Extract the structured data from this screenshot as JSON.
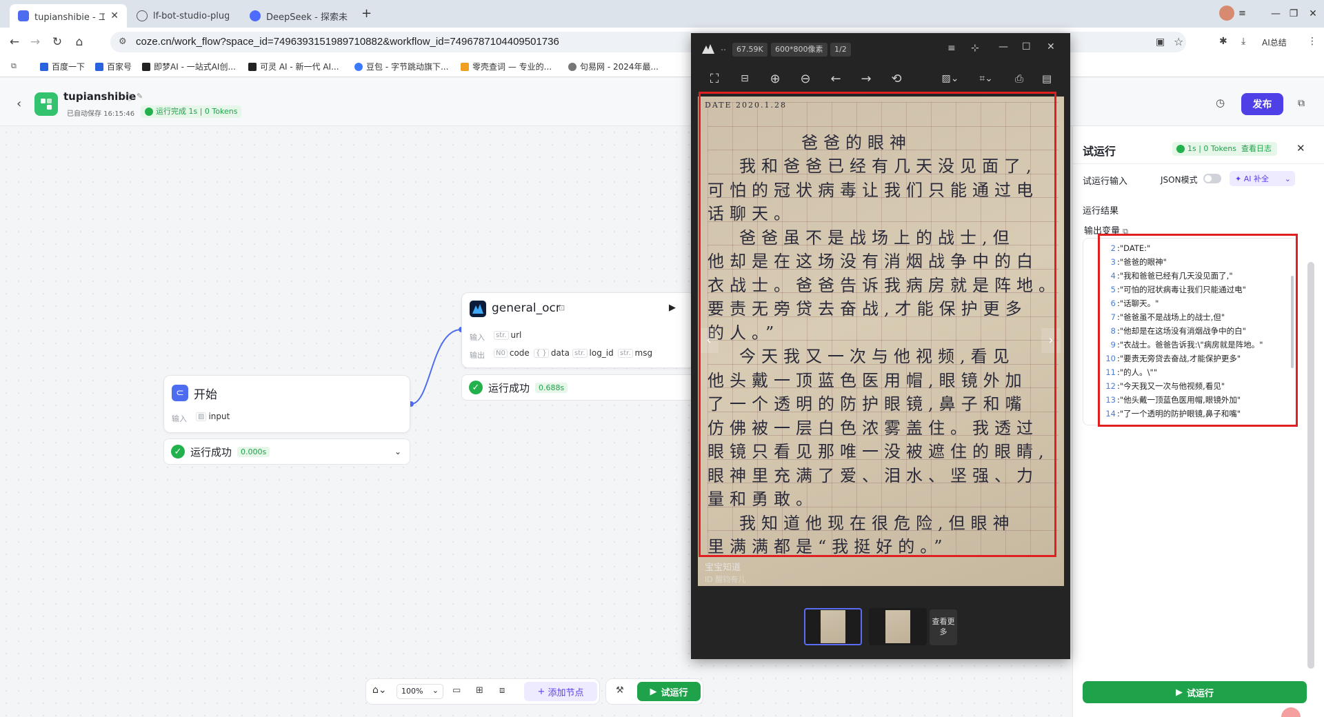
{
  "browser": {
    "tabs": [
      {
        "title": "tupianshibie - 工",
        "color": "#4d6cf0"
      },
      {
        "title": "lf-bot-studio-plugin-",
        "color": "#555555"
      },
      {
        "title": "DeepSeek - 探索未至",
        "color": "#4d6bfe"
      }
    ],
    "new_tab": "+",
    "url": "coze.cn/work_flow?space_id=7496393151989710882&workflow_id=7496787104409501736",
    "ai_label": "AI总结",
    "bookmarks": [
      "百度一下",
      "百家号",
      "即梦AI - 一站式AI创...",
      "可灵 AI - 新一代 AI...",
      "豆包 - 字节跳动旗下...",
      "零壳查词 — 专业的...",
      "句易网 - 2024年最..."
    ],
    "bookmark_colors": [
      "#2b62e0",
      "#2b62e0",
      "#222222",
      "#222222",
      "#3a7afe",
      "#f0a020",
      "#777777"
    ]
  },
  "header": {
    "workflow_name": "tupianshibie",
    "autosave": "已自动保存 16:15:46",
    "run_status": "运行完成 1s | 0 Tokens",
    "publish": "发布"
  },
  "nodes": {
    "start": {
      "title": "开始",
      "input_label": "输入",
      "input_var": "input",
      "result": "运行成功",
      "time": "0.000s"
    },
    "ocr": {
      "title": "general_ocr",
      "input_label": "输入",
      "input_type": "str.",
      "input_var": "url",
      "output_label": "输出",
      "outputs": [
        {
          "type": "N0",
          "name": "code"
        },
        {
          "type": "{ }",
          "name": "data"
        },
        {
          "type": "str.",
          "name": "log_id"
        },
        {
          "type": "str.",
          "name": "msg"
        }
      ],
      "result": "运行成功",
      "time": "0.688s"
    }
  },
  "toolbar": {
    "zoom": "100%",
    "add_node": "添加节点",
    "test_run": "试运行"
  },
  "panel": {
    "title": "试运行",
    "badge": "1s | 0 Tokens",
    "log_link": "查看日志",
    "input_label": "试运行输入",
    "json_mode": "JSON模式",
    "ai_fill": "AI 补全",
    "result_label": "运行结果",
    "output_var_label": "输出变量",
    "output_lines": [
      {
        "n": "2",
        "text": ":\"DATE:\""
      },
      {
        "n": "3",
        "text": ":\"爸爸的眼神\""
      },
      {
        "n": "4",
        "text": ":\"我和爸爸已经有几天没见面了,\""
      },
      {
        "n": "5",
        "text": ":\"可怕的冠状病毒让我们只能通过电\""
      },
      {
        "n": "6",
        "text": ":\"话聊天。\""
      },
      {
        "n": "7",
        "text": ":\"爸爸虽不是战场上的战士,但\""
      },
      {
        "n": "8",
        "text": ":\"他却是在这场没有消烟战争中的白\""
      },
      {
        "n": "9",
        "text": ":\"衣战士。爸爸告诉我:\\\"病房就是阵地。\""
      },
      {
        "n": "10",
        "text": ":\"要责无旁贷去奋战,才能保护更多\""
      },
      {
        "n": "11",
        "text": ":\"的人。\\\"\""
      },
      {
        "n": "12",
        "text": ":\"今天我又一次与他视频,看见\""
      },
      {
        "n": "13",
        "text": ":\"他头戴一顶蓝色医用帽,眼镜外加\""
      },
      {
        "n": "14",
        "text": ":\"了一个透明的防护眼镜,鼻子和嘴\""
      }
    ],
    "run_button": "试运行"
  },
  "viewer": {
    "size_tag": "67.59K",
    "dims_tag": "600*800像素",
    "page_tag": "1/2",
    "more": "查看更多",
    "watermark": "宝宝知道",
    "watermark_id": "ID  醒钧有儿",
    "handwriting": [
      "DATE  2020.1.28",
      "爸爸的眼神",
      "我和爸爸已经有几天没见面了,",
      "可怕的冠状病毒让我们只能通过电",
      "话聊天。",
      "爸爸虽不是战场上的战士,但",
      "他却是在这场没有消烟战争中的白",
      "衣战士。爸爸告诉我病房就是阵地。",
      "要责无旁贷去奋战,才能保护更多",
      "的人。”",
      "今天我又一次与他视频,看见",
      "他头戴一顶蓝色医用帽,眼镜外加",
      "了一个透明的防护眼镜,鼻子和嘴",
      "仿佛被一层白色浓雾盖住。我透过",
      "眼镜只看见那唯一没被遮住的眼睛,",
      "眼神里充满了爱、泪水、坚强、力",
      "量和勇敢。",
      "我知道他现在很危险,但眼神",
      "里满满都是“我挺好的。”"
    ]
  }
}
